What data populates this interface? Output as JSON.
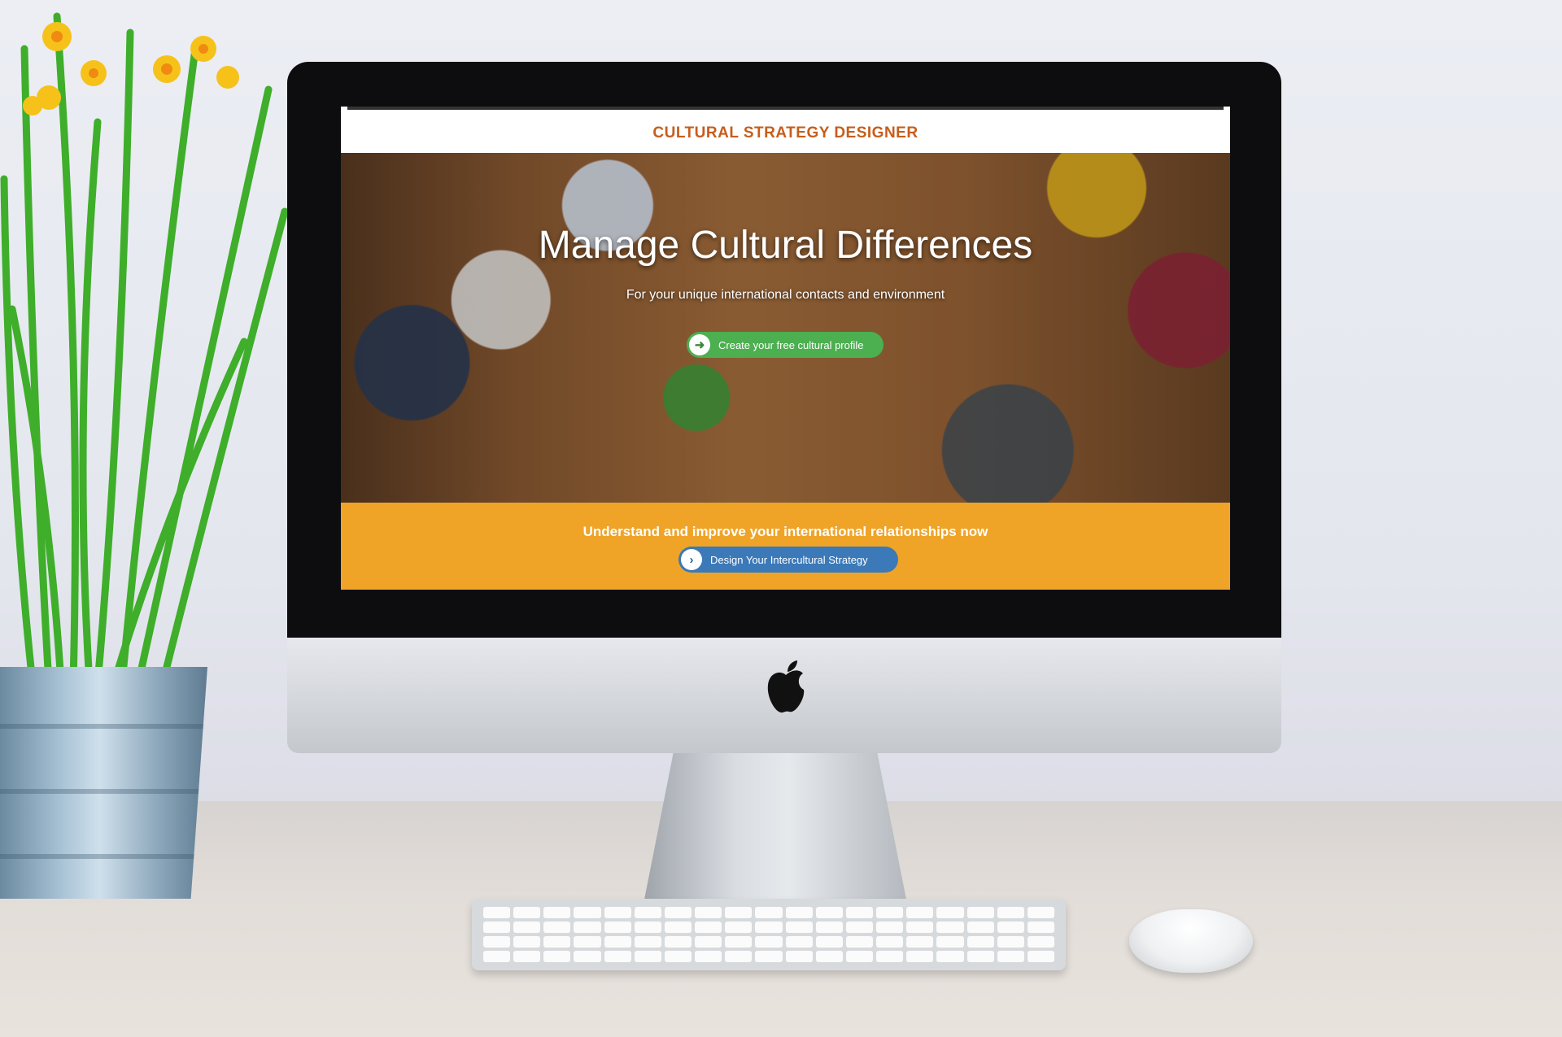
{
  "site": {
    "brand_title": "CULTURAL STRATEGY DESIGNER"
  },
  "hero": {
    "title": "Manage Cultural Differences",
    "subtitle": "For your unique international contacts and environment",
    "primary_button": {
      "label": "Create your free cultural profile",
      "icon": "arrow-right-icon"
    }
  },
  "cta": {
    "text": "Understand and improve your international relationships now",
    "button": {
      "label": "Design Your Intercultural Strategy",
      "icon": "chevron-right-icon"
    }
  },
  "colors": {
    "brand_orange": "#c75d1b",
    "band_orange": "#efa428",
    "button_green": "#4caf50",
    "button_blue": "#3b79b8"
  }
}
